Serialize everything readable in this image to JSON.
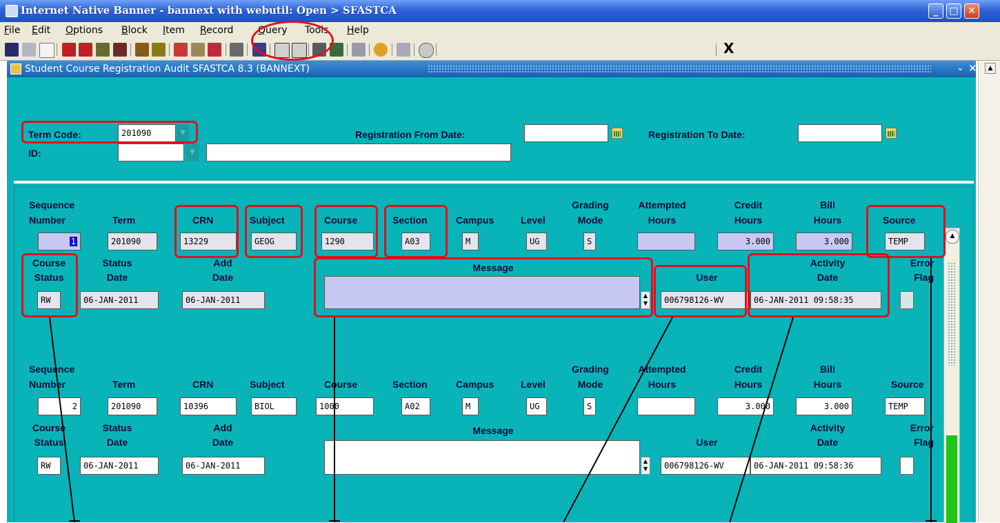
{
  "window": {
    "title": "Internet Native Banner - bannext with webutil:  Open > SFASTCA",
    "controls": {
      "minimize": "_",
      "maximize": "□",
      "close": "✕"
    }
  },
  "menu": [
    {
      "first": "F",
      "rest": "ile"
    },
    {
      "first": "E",
      "rest": "dit"
    },
    {
      "first": "O",
      "rest": "ptions"
    },
    {
      "first": "B",
      "rest": "lock"
    },
    {
      "first": "I",
      "rest": "tem"
    },
    {
      "first": "R",
      "rest": "ecord"
    },
    {
      "first": "Q",
      "rest": "uery"
    },
    {
      "first": "",
      "rest": "Tools"
    },
    {
      "first": "H",
      "rest": "elp"
    }
  ],
  "toolbar": {
    "icons": [
      "save-icon",
      "rollback-icon",
      "print-icon",
      "insert-record-icon",
      "remove-record-icon",
      "next-block-icon",
      "previous-block-icon",
      "next-record-icon",
      "previous-record-icon",
      "enter-query-icon",
      "execute-query-icon",
      "cancel-query-icon",
      "export-icon",
      "print-screen-icon",
      "first-record-icon",
      "last-record-icon",
      "options-icon",
      "block-options-icon",
      "sound-icon",
      "navigate-icon",
      "home-icon",
      "help-icon"
    ],
    "exit_label": "X"
  },
  "form": {
    "title": "Student Course Registration Audit  SFASTCA  8.3  (BANNEXT)",
    "min_glyph": "⌄",
    "close_glyph": "✕"
  },
  "key_block": {
    "term_code_label": "Term Code:",
    "term_code_value": "201090",
    "id_label": "ID:",
    "id_value": "",
    "name_value": "",
    "reg_from_label": "Registration From Date:",
    "reg_from_value": "",
    "reg_to_label": "Registration To Date:",
    "reg_to_value": ""
  },
  "labels": {
    "sequence": "Sequence",
    "number": "Number",
    "term": "Term",
    "crn": "CRN",
    "subject": "Subject",
    "course": "Course",
    "section": "Section",
    "campus": "Campus",
    "level": "Level",
    "grading": "Grading",
    "mode": "Mode",
    "attempted": "Attempted",
    "hours": "Hours",
    "credit": "Credit",
    "bill": "Bill",
    "source": "Source",
    "course2": "Course",
    "status": "Status",
    "status2": "Status",
    "date": "Date",
    "add": "Add",
    "message": "Message",
    "user": "User",
    "activity": "Activity",
    "error": "Error",
    "flag": "Flag"
  },
  "records": [
    {
      "sequence": "1",
      "term": "201090",
      "crn": "13229",
      "subject": "GEOG",
      "course": "1290",
      "section": "A03",
      "campus": "M",
      "level": "UG",
      "grading_mode": "S",
      "attempted_hours": "",
      "credit_hours": "3.000",
      "bill_hours": "3.000",
      "source": "TEMP",
      "course_status": "RW",
      "status_date": "06-JAN-2011",
      "add_date": "06-JAN-2011",
      "message": "",
      "user": "006798126-WV",
      "activity_date": "06-JAN-2011 09:58:35",
      "error_flag": ""
    },
    {
      "sequence": "2",
      "term": "201090",
      "crn": "10396",
      "subject": "BIOL",
      "course": "1000",
      "section": "A02",
      "campus": "M",
      "level": "UG",
      "grading_mode": "S",
      "attempted_hours": "",
      "credit_hours": "3.000",
      "bill_hours": "3.000",
      "source": "TEMP",
      "course_status": "RW",
      "status_date": "06-JAN-2011",
      "add_date": "06-JAN-2011",
      "message": "",
      "user": "006798126-WV",
      "activity_date": "06-JAN-2011 09:58:36",
      "error_flag": ""
    }
  ],
  "annotation": {
    "color": "#e0101c",
    "line_color": "#000000"
  }
}
